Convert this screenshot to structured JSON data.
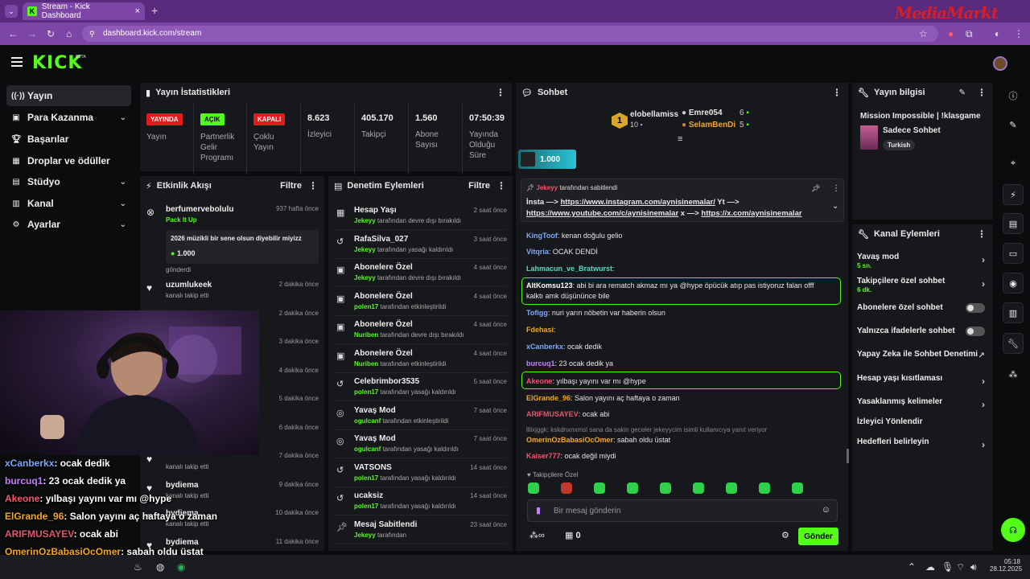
{
  "browser": {
    "tab_title": "Stream - Kick Dashboard",
    "url": "dashboard.kick.com/stream",
    "brand_overlay": "MediaMarkt"
  },
  "header": {
    "logo": "KICK",
    "logo_tag": "BETA"
  },
  "sidebar": {
    "items": [
      {
        "label": "Yayın",
        "icon": "broadcast-icon"
      },
      {
        "label": "Para Kazanma",
        "icon": "money-icon"
      },
      {
        "label": "Başarılar",
        "icon": "trophy-icon"
      },
      {
        "label": "Droplar ve ödüller",
        "icon": "gift-icon"
      },
      {
        "label": "Stüdyo",
        "icon": "studio-icon"
      },
      {
        "label": "Kanal",
        "icon": "grid-icon"
      },
      {
        "label": "Ayarlar",
        "icon": "gear-icon"
      }
    ]
  },
  "stats": {
    "title": "Yayın İstatistikleri",
    "live_badge": "YAYINDA",
    "live_label": "Yayın",
    "partner_badge": "AÇIK",
    "partner_label": "Partnerlik Gelir Programı",
    "multi_badge": "KAPALI",
    "multi_label": "Çoklu Yayın",
    "viewers": "8.623",
    "viewers_label": "İzleyici",
    "followers": "405.170",
    "followers_label": "Takipçi",
    "subs": "1.560",
    "subs_label": "Abone Sayısı",
    "uptime": "07:50:39",
    "uptime_label": "Yayında Olduğu Süre"
  },
  "activity": {
    "title": "Etkinlik Akışı",
    "filter": "Filtre",
    "first": {
      "user": "berfumervebolulu",
      "action": "Pack It Up",
      "time": "937 hafta önce",
      "message": "2026 müzikli bir sene olsun diyebilir miyizz",
      "amount": "1.000",
      "suffix": "gönderdi"
    },
    "rows": [
      {
        "user": "uzumlukeek",
        "sub": "kanalı takip etti",
        "time": "2 dakika önce"
      },
      {
        "user": "",
        "sub": "",
        "time": "2 dakika önce"
      },
      {
        "user": "",
        "sub": "",
        "time": "3 dakika önce"
      },
      {
        "user": "",
        "sub": "",
        "time": "4 dakika önce"
      },
      {
        "user": "",
        "sub": "",
        "time": "5 dakika önce"
      },
      {
        "user": "",
        "sub": "",
        "time": "6 dakika önce"
      },
      {
        "user": "",
        "sub": "kanalı takip etti",
        "time": "7 dakika önce"
      },
      {
        "user": "bydiema",
        "sub": "kanalı takip etti",
        "time": "9 dakika önce"
      },
      {
        "user": "bydiema",
        "sub": "kanalı takip etti",
        "time": "10 dakika önce"
      },
      {
        "user": "bydiema",
        "sub": "",
        "time": "11 dakika önce"
      }
    ]
  },
  "moderation": {
    "title": "Denetim Eylemleri",
    "filter": "Filtre",
    "rows": [
      {
        "title": "Hesap Yaşı",
        "by": "Jekeyy",
        "rest": "tarafından devre dışı bırakıldı",
        "time": "2 saat önce",
        "icon": "calendar-icon"
      },
      {
        "title": "RafaSilva_027",
        "by": "Jekeyy",
        "rest": "tarafından yasağı kaldırıldı",
        "time": "3 saat önce",
        "icon": "undo-icon"
      },
      {
        "title": "Abonelere Özel",
        "by": "Jekeyy",
        "rest": "tarafından devre dışı bırakıldı",
        "time": "4 saat önce",
        "icon": "gift-icon"
      },
      {
        "title": "Abonelere Özel",
        "by": "polen17",
        "rest": "tarafından etkinleştirildi",
        "time": "4 saat önce",
        "icon": "gift-icon"
      },
      {
        "title": "Abonelere Özel",
        "by": "Nuriben",
        "rest": "tarafından devre dışı bırakıldı",
        "time": "4 saat önce",
        "icon": "gift-icon"
      },
      {
        "title": "Abonelere Özel",
        "by": "Nuriben",
        "rest": "tarafından etkinleştirildi",
        "time": "4 saat önce",
        "icon": "gift-icon"
      },
      {
        "title": "Celebrimbor3535",
        "by": "polen17",
        "rest": "tarafından yasağı kaldırıldı",
        "time": "5 saat önce",
        "icon": "undo-icon"
      },
      {
        "title": "Yavaş Mod",
        "by": "ogulcanf",
        "rest": "tarafından etkinleştirildi",
        "time": "7 saat önce",
        "icon": "snail-icon"
      },
      {
        "title": "Yavaş Mod",
        "by": "ogulcanf",
        "rest": "tarafından yasağı kaldırıldı",
        "time": "7 saat önce",
        "icon": "snail-icon"
      },
      {
        "title": "VATSONS",
        "by": "polen17",
        "rest": "tarafından yasağı kaldırıldı",
        "time": "14 saat önce",
        "icon": "undo-icon"
      },
      {
        "title": "ucaksiz",
        "by": "polen17",
        "rest": "tarafından yasağı kaldırıldı",
        "time": "14 saat önce",
        "icon": "undo-icon"
      },
      {
        "title": "Mesaj Sabitlendi",
        "by": "Jekeyy",
        "rest": "tarafından",
        "time": "23 saat önce",
        "icon": "pin-icon"
      }
    ]
  },
  "chat": {
    "title": "Sohbet",
    "leader_rank": "1",
    "leader_name": "elobellamiss",
    "leader_score": "10",
    "second_name": "Emre054",
    "second_score": "6",
    "third_name": "SelamBenDi",
    "third_score": "5",
    "goal_amount": "1.000",
    "pinned_by": "Jekeyy",
    "pinned_text": "tarafından sabitlendi",
    "pinned_line1_a": "İnsta —> ",
    "pinned_link1": "https://www.instagram.com/aynisinemalar/",
    "pinned_line1_b": " Yt —>",
    "pinned_link2": "https://www.youtube.com/c/aynisinemalar",
    "pinned_line2_b": " x —> ",
    "pinned_link3": "https://x.com/aynisinemalar",
    "messages": [
      {
        "user": "KingToof",
        "color": "#7da7ff",
        "text": ": kenan doğulu gelio"
      },
      {
        "user": "Vitqria",
        "color": "#7da7ff",
        "text": ": OCAK DENDİ"
      },
      {
        "user": "Lahmacun_ve_Bratwurst",
        "color": "#5ed6c2",
        "text": ":"
      },
      {
        "user": "AltKomsu123",
        "color": "#ffffff",
        "text": ": abi bi ara rematch akmaz mı ya @hype öpücük atıp pas istiyoruz falan offf"
      },
      {
        "user": "",
        "color": "#ffffff",
        "text": "kalktı amk düşününce bile"
      },
      {
        "user": "Tofigg",
        "color": "#7da7ff",
        "text": ": nuri yarın nöbetin var haberin olsun"
      },
      {
        "user": "Fdehasi",
        "color": "#f5a623",
        "text": ":"
      },
      {
        "user": "xCanberkx",
        "color": "#7da7ff",
        "text": ": ocak dedik"
      },
      {
        "user": "burcuq1",
        "color": "#c77dff",
        "text": ": 23 ocak dedik ya"
      },
      {
        "user": "Akeone",
        "color": "#ff4f6b",
        "text": ": yılbaşı yayını var mı @hype"
      },
      {
        "user": "ElGrande_96",
        "color": "#f5a623",
        "text": ": Salon yayını aç haftaya o zaman"
      },
      {
        "user": "ARIFMUSAYEV",
        "color": "#e2566f",
        "text": ": ocak abi"
      },
      {
        "user": "",
        "color": "#888888",
        "text": "lllixjggk: kskdnxnxmsl sana da sakin geceler jekeyycim isimli kullanıcıya yanıt veriyor"
      },
      {
        "user": "OmerinOzBabasiOcOmer",
        "color": "#f5a623",
        "text": ": sabah oldu üstat"
      },
      {
        "user": "Kaiser777",
        "color": "#ff4f6b",
        "text": ": ocak değil miydi"
      }
    ],
    "follower_only": "Takipçilere Özel",
    "input_placeholder": "Bir mesaj gönderin",
    "points": "0",
    "send": "Gönder"
  },
  "streaminfo": {
    "title": "Yayın bilgisi",
    "stream_title": "Mission Impossible | !klasgame",
    "category": "Sadece Sohbet",
    "tag": "Turkish"
  },
  "channel_actions": {
    "title": "Kanal Eylemleri",
    "rows": [
      {
        "label": "Yavaş mod",
        "sub": "5 sn.",
        "control": "chevron"
      },
      {
        "label": "Takipçilere özel sohbet",
        "sub": "6 dk.",
        "control": "chevron"
      },
      {
        "label": "Abonelere özel sohbet",
        "sub": "",
        "control": "toggle"
      },
      {
        "label": "Yalnızca ifadelerle sohbet",
        "sub": "",
        "control": "toggle"
      },
      {
        "label": "Yapay Zeka ile Sohbet Denetimi",
        "sub": "",
        "control": "external"
      },
      {
        "label": "Hesap yaşı kısıtlaması",
        "sub": "",
        "control": "chevron"
      },
      {
        "label": "Yasaklanmış kelimeler",
        "sub": "",
        "control": "chevron"
      },
      {
        "label": "İzleyici Yönlendir",
        "sub": "",
        "control": "none"
      },
      {
        "label": "Hedefleri belirleyin",
        "sub": "",
        "control": "chevron"
      }
    ]
  },
  "overlay_chat": [
    {
      "user": "xCanberkx",
      "color": "#7da7ff",
      "text": ": ocak dedik"
    },
    {
      "user": "burcuq1",
      "color": "#c77dff",
      "text": ": 23 ocak dedik ya"
    },
    {
      "user": "Akeone",
      "color": "#ff4f6b",
      "text": ": yılbaşı yayını var mı @hype"
    },
    {
      "user": "ElGrande_96",
      "color": "#f5a623",
      "text": ": Salon yayını aç haftaya o zaman"
    },
    {
      "user": "ARIFMUSAYEV",
      "color": "#e2566f",
      "text": ": ocak abi"
    },
    {
      "user": "OmerinOzBabasiOcOmer",
      "color": "#f5a623",
      "text": ": sabah oldu üstat"
    },
    {
      "user": "Kaiser777",
      "color": "#ff4f6b",
      "text": ": ocak değil miydi"
    }
  ],
  "taskbar": {
    "time": "05:18",
    "date": "28.12.2025"
  },
  "colors": {
    "accent": "#53fc18",
    "live": "#e21b1b",
    "panel": "#17181c",
    "bg": "#0b0c0e"
  }
}
